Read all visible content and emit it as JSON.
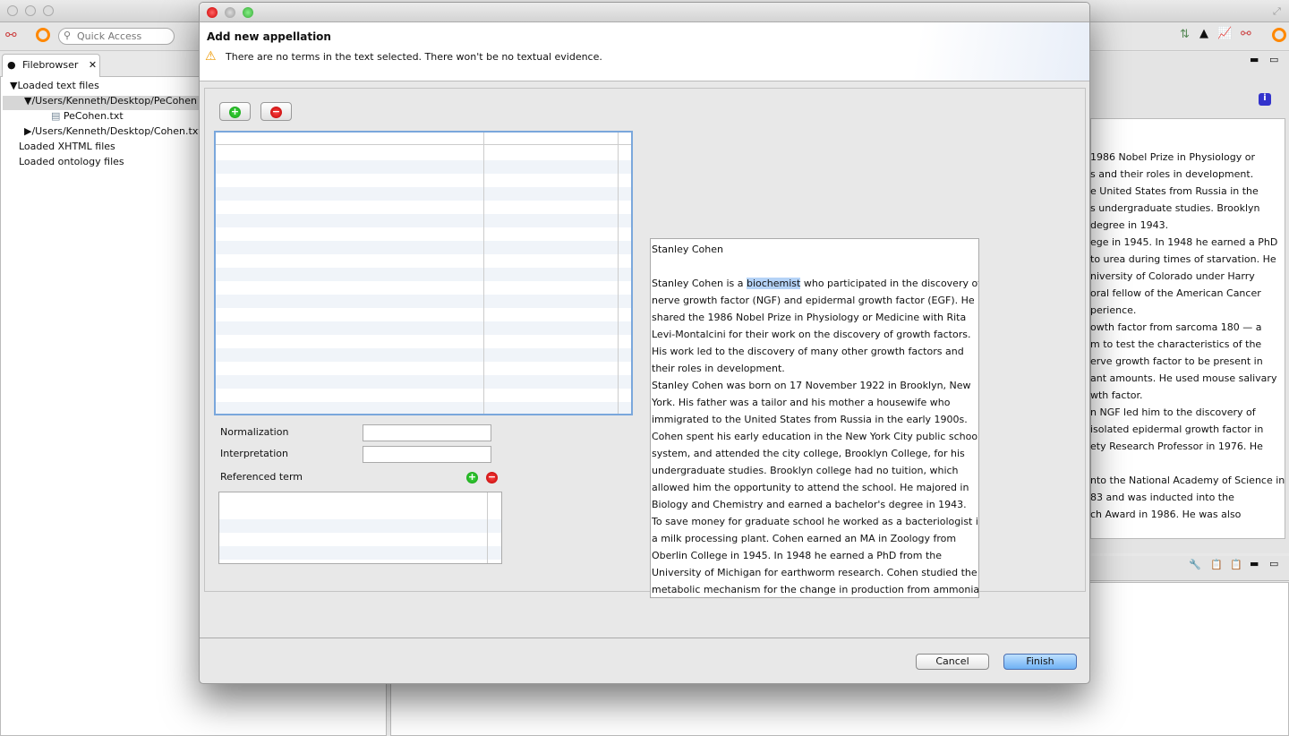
{
  "app": {
    "quick_access_placeholder": "Quick Access"
  },
  "filebrowser": {
    "tab_label": "Filebrowser",
    "items": [
      "Loaded text files",
      "/Users/Kenneth/Desktop/PeCohen",
      "PeCohen.txt",
      "/Users/Kenneth/Desktop/Cohen.txt",
      "Loaded XHTML files",
      "Loaded ontology files"
    ]
  },
  "background_text": [
    "1986 Nobel Prize in Physiology or",
    "s and their roles in development.",
    "e United States from Russia in the",
    "s undergraduate studies.  Brooklyn",
    "degree in 1943.",
    "ege in 1945.  In 1948 he earned a PhD",
    "to urea during times of starvation.  He",
    "niversity of Colorado under Harry",
    "oral fellow of the American Cancer",
    "perience.",
    "owth factor from sarcoma 180 — a",
    "m to test the characteristics of the",
    "erve growth factor to be present in",
    "ant amounts.  He used mouse salivary",
    "wth factor.",
    "n NGF led him to the discovery of",
    "isolated epidermal growth factor in",
    "ety Research Professor in 1976.  He",
    "",
    "nto the National Academy of Science in",
    "83 and was inducted into the",
    "ch Award in 1986.  He was also"
  ],
  "dialog": {
    "title": "Add new appellation",
    "warning": "There are no terms in the text selected. There won't be no textual evidence.",
    "add_symbol": "+",
    "remove_symbol": "−",
    "normalization_label": "Normalization",
    "normalization_value": "",
    "interpretation_label": "Interpretation",
    "interpretation_value": "",
    "referenced_term_label": "Referenced term",
    "text_before": "Stanley Cohen is a ",
    "text_selected": "biochemist",
    "text_after": " who participated in the discovery of",
    "text_title": "Stanley Cohen",
    "text_lines": [
      "nerve growth factor (NGF) and epidermal growth factor (EGF).  He",
      "shared the 1986 Nobel Prize in Physiology or Medicine with Rita",
      "Levi-Montalcini for their work on the discovery of growth factors.",
      "His work led to the discovery of many other growth factors and",
      "their roles in development.",
      "Stanley Cohen was born on 17 November 1922 in Brooklyn, New",
      "York.  His father was a tailor and his mother a housewife who",
      "immigrated to the United States from Russia in the early 1900s.",
      "Cohen spent his early education in the New York City public school",
      "system, and attended the city college, Brooklyn College, for his",
      "undergraduate studies.  Brooklyn college had no tuition, which",
      "allowed him the opportunity to attend the school.   He majored in",
      "Biology and Chemistry and earned a bachelor's degree in 1943.",
      "To save money for graduate school he worked as a bacteriologist in",
      "a milk processing plant.  Cohen earned an MA in Zoology from",
      "Oberlin College in 1945.  In 1948 he earned a PhD from the",
      "University of Michigan for earthworm research.  Cohen studied the",
      "metabolic mechanism for the change in production from ammonia"
    ],
    "cancel_label": "Cancel",
    "finish_label": "Finish"
  }
}
